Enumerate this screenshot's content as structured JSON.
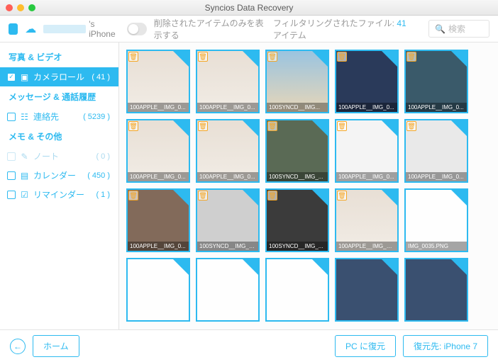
{
  "title": "Syncios Data Recovery",
  "device_suffix": "'s iPhone",
  "toggle_label": "削除されたアイテムのみを表示する",
  "filter_prefix": "フィルタリングされたファイル:",
  "filter_count": "41",
  "filter_suffix": " アイテム",
  "search_placeholder": "検索",
  "sidebar": {
    "s1": "写真 & ビデオ",
    "camroll": "カメラロール",
    "camroll_cnt": "( 41 )",
    "s2": "メッセージ & 通話履歴",
    "contacts": "連絡先",
    "contacts_cnt": "( 5239 )",
    "s3": "メモ & その他",
    "notes": "ノート",
    "notes_cnt": "( 0 )",
    "calendar": "カレンダー",
    "calendar_cnt": "( 450 )",
    "reminders": "リマインダー",
    "reminders_cnt": "( 1 )"
  },
  "thumbs": [
    {
      "cap": "100APPLE__IMG_0...",
      "cls": "bg-cat",
      "trash": true
    },
    {
      "cap": "100APPLE__IMG_0...",
      "cls": "bg-cat",
      "trash": true
    },
    {
      "cap": "100SYNCD__IMG...",
      "cls": "bg-sea",
      "trash": true
    },
    {
      "cap": "100APPLE__IMG_0...",
      "cls": "bg-proj",
      "trash": true
    },
    {
      "cap": "100APPLE__IMG_0...",
      "cls": "bg-car",
      "trash": true
    },
    {
      "cap": "100APPLE__IMG_0...",
      "cls": "bg-cat",
      "trash": true
    },
    {
      "cap": "100APPLE__IMG_0...",
      "cls": "bg-cat",
      "trash": true
    },
    {
      "cap": "100SYNCD__IMG_...",
      "cls": "bg-ipad",
      "trash": true
    },
    {
      "cap": "100APPLE__IMG_0...",
      "cls": "bg-white",
      "trash": true
    },
    {
      "cap": "100APPLE__IMG_0...",
      "cls": "bg-phone",
      "trash": true
    },
    {
      "cap": "100APPLE__IMG_0...",
      "cls": "bg-book",
      "trash": true
    },
    {
      "cap": "100SYNCD__IMG_0...",
      "cls": "bg-tab",
      "trash": true
    },
    {
      "cap": "100SYNCD__IMG_...",
      "cls": "bg-wall",
      "trash": true
    },
    {
      "cap": "100APPLE__IMG_N...",
      "cls": "bg-cat",
      "trash": true
    },
    {
      "cap": "IMG_0035.PNG",
      "cls": "bg-doc",
      "trash": false
    },
    {
      "cap": "",
      "cls": "bg-doc",
      "trash": false
    },
    {
      "cap": "",
      "cls": "bg-doc",
      "trash": false
    },
    {
      "cap": "",
      "cls": "bg-doc",
      "trash": false
    },
    {
      "cap": "",
      "cls": "bg-home",
      "trash": false
    },
    {
      "cap": "",
      "cls": "bg-home",
      "trash": false
    }
  ],
  "footer": {
    "home": "ホーム",
    "pc": "PC に復元",
    "device": "復元先: iPhone 7"
  }
}
